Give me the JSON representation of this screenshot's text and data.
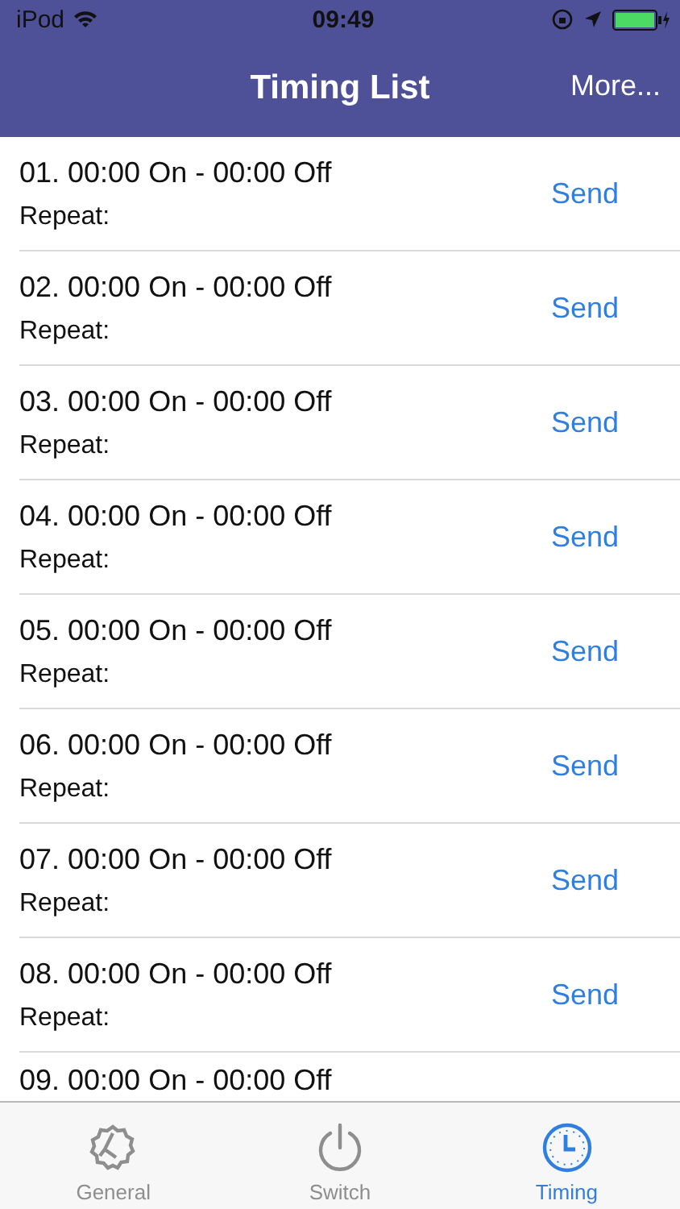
{
  "status_bar": {
    "carrier": "iPod",
    "time": "09:49"
  },
  "nav": {
    "title": "Timing List",
    "right_button": "More..."
  },
  "rows": [
    {
      "kind": "full",
      "title": "01. 00:00 On - 00:00 Off",
      "subtitle": "Repeat:",
      "action": "Send"
    },
    {
      "kind": "full",
      "title": "02. 00:00 On - 00:00 Off",
      "subtitle": "Repeat:",
      "action": "Send"
    },
    {
      "kind": "full",
      "title": "03. 00:00 On - 00:00 Off",
      "subtitle": "Repeat:",
      "action": "Send"
    },
    {
      "kind": "full",
      "title": "04. 00:00 On - 00:00 Off",
      "subtitle": "Repeat:",
      "action": "Send"
    },
    {
      "kind": "full",
      "title": "05. 00:00 On - 00:00 Off",
      "subtitle": "Repeat:",
      "action": "Send"
    },
    {
      "kind": "full",
      "title": "06. 00:00 On - 00:00 Off",
      "subtitle": "Repeat:",
      "action": "Send"
    },
    {
      "kind": "full",
      "title": "07. 00:00 On - 00:00 Off",
      "subtitle": "Repeat:",
      "action": "Send"
    },
    {
      "kind": "full",
      "title": "08. 00:00 On - 00:00 Off",
      "subtitle": "Repeat:",
      "action": "Send"
    },
    {
      "kind": "partial",
      "title": "09. 00:00 On - 00:00 Off"
    }
  ],
  "tabs": [
    {
      "kind": "gear",
      "label": "General",
      "selected": false
    },
    {
      "kind": "power",
      "label": "Switch",
      "selected": false
    },
    {
      "kind": "clock",
      "label": "Timing",
      "selected": true
    }
  ]
}
